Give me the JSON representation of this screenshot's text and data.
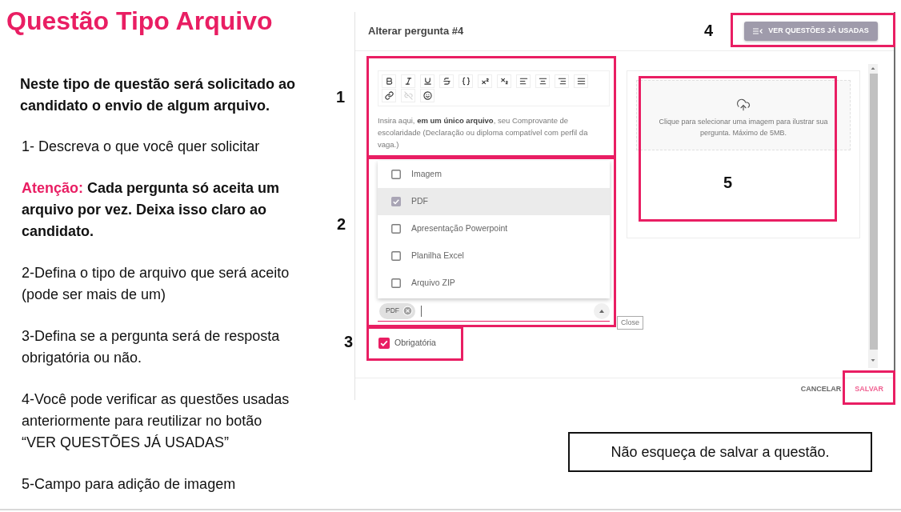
{
  "slide": {
    "title": "Questão Tipo Arquivo",
    "intro": "Neste tipo de questão será solicitado ao candidato o envio de algum arquivo.",
    "steps": [
      {
        "kind": "plain",
        "text": "1- Descreva o que você quer solicitar"
      },
      {
        "kind": "warning",
        "label": "Atenção:",
        "text": "Cada pergunta só aceita um arquivo por vez. Deixa isso claro ao candidato."
      },
      {
        "kind": "plain",
        "text": "2-Defina o tipo de arquivo que será aceito (pode ser mais de um)"
      },
      {
        "kind": "plain",
        "text": "3-Defina se a pergunta será de resposta obrigatória ou não."
      },
      {
        "kind": "plain",
        "text": "4-Você pode verificar as questões usadas anteriormente para reutilizar no botão “VER QUESTÕES JÁ USADAS”"
      },
      {
        "kind": "plain",
        "text": "5-Campo para adição de imagem"
      }
    ],
    "note": "Não esqueça de salvar a questão."
  },
  "callouts": [
    {
      "number": "1"
    },
    {
      "number": "2"
    },
    {
      "number": "3"
    },
    {
      "number": "4"
    },
    {
      "number": "5"
    }
  ],
  "dialog": {
    "title": "Alterar pergunta #4",
    "used_questions_button": "VER QUESTÕES JÁ USADAS",
    "editor": {
      "toolbar": [
        {
          "kind": "bold",
          "disabled": false
        },
        {
          "kind": "italic",
          "disabled": false
        },
        {
          "kind": "underline",
          "disabled": false
        },
        {
          "kind": "strikethrough",
          "disabled": false
        },
        {
          "kind": "code",
          "disabled": false
        },
        {
          "kind": "superscript",
          "disabled": false
        },
        {
          "kind": "subscript",
          "disabled": false
        },
        {
          "kind": "align_left",
          "disabled": false
        },
        {
          "kind": "align_center",
          "disabled": false
        },
        {
          "kind": "align_right",
          "disabled": false
        },
        {
          "kind": "justify",
          "disabled": false
        },
        {
          "kind": "link",
          "disabled": false
        },
        {
          "kind": "unlink",
          "disabled": true
        },
        {
          "kind": "emoji",
          "disabled": false
        }
      ],
      "content": "Insira aqui, **em um único arquivo**, seu Comprovante de escolaridade (Declaração ou diploma compatível com perfil da vaga.)"
    },
    "file_types": {
      "options": [
        {
          "label": "Imagem",
          "checked": false,
          "selected": false
        },
        {
          "label": "PDF",
          "checked": true,
          "selected": true
        },
        {
          "label": "Apresentação Powerpoint",
          "checked": false,
          "selected": false
        },
        {
          "label": "Planilha Excel",
          "checked": false,
          "selected": false
        },
        {
          "label": "Arquivo ZIP",
          "checked": false,
          "selected": false
        }
      ],
      "chips": [
        {
          "label": "PDF"
        }
      ],
      "tooltip": "Close"
    },
    "required": {
      "label": "Obrigatória",
      "checked": true
    },
    "image_upload": {
      "hint": "Clique para selecionar uma imagem para ilustrar sua pergunta. Máximo de 5MB."
    },
    "buttons": [
      {
        "label": "CANCELAR",
        "kind": "secondary"
      },
      {
        "label": "SALVAR",
        "kind": "primary"
      }
    ]
  }
}
